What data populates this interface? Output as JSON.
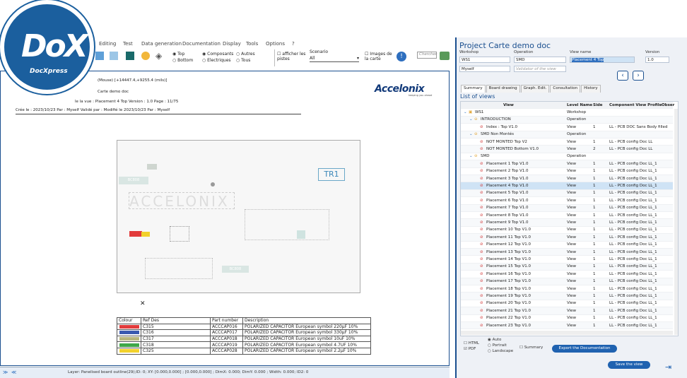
{
  "logo": {
    "brand": "DoX",
    "sub": "DocXpress"
  },
  "menu": [
    "Editing",
    "Test",
    "Data generation",
    "Documentation",
    "Display",
    "Tools",
    "Options",
    "?"
  ],
  "toolbar": {
    "top_label": "Top",
    "bottom_label": "Bottom",
    "composants": "Composants",
    "electriques": "Electriques",
    "autres": "Autres",
    "tous": "Tous",
    "afficher_pistes": "afficher les pistes",
    "scenario_label": "Scenario",
    "scenario_value": "All",
    "images_carte": "Images de la carte",
    "search_placeholder": "Chercher"
  },
  "doc": {
    "mouse": "(Mouse) [+14447.4,+9255.4 (mils)]",
    "project": "Carte demo doc",
    "view_line": "le la vue : Placement 4 Top   Version : 1.0   Page : 11/75",
    "created_line": "Crée le :  2023/10/23    Par : Myself   Validé par :     Modifié le 2023/10/23    Par : Myself",
    "brand": "Accelonix",
    "brand_tag": "keeping you ahead",
    "board_text1": "TR1",
    "board_text2": "ACCELONIX",
    "board_text3": "BC808",
    "board_text4": "BC808",
    "legend_headers": [
      "Colour",
      "Ref Des",
      "Part number",
      "Description"
    ],
    "legend_rows": [
      {
        "color": "#e23b3b",
        "ref": "C315",
        "part": "ACCCAP016",
        "desc": "POLARIZED CAPACITOR European symbol 220µF 10%"
      },
      {
        "color": "#3b5ab0",
        "ref": "C316",
        "part": "ACCCAP017",
        "desc": "POLARIZED CAPACITOR European symbol 330µF 10%"
      },
      {
        "color": "#b9b77e",
        "ref": "C317",
        "part": "ACCCAP018",
        "desc": "POLARIZED CAPACITOR European symbol 10uF 10%"
      },
      {
        "color": "#3fa748",
        "ref": "C318",
        "part": "ACCCAP019",
        "desc": "POLARIZED CAPACITOR European symbol 4.7UF 10%"
      },
      {
        "color": "#f2d12c",
        "ref": "C325",
        "part": "ACCCAP028",
        "desc": "POLARIZED CAPACITOR European symbol 2.2µF 10%"
      }
    ]
  },
  "status": "Layer: Panelised board outline(29);ID: 0; XY: [0.000,0.000] ; [0.000,0.000] ; DimX: 0.000; DimY: 0.000 ; Width: 0.000; ID2: 0",
  "panel": {
    "title": "Project  Carte demo doc",
    "workshop_label": "Workshop",
    "operation_label": "Operation",
    "viewname_label": "View name",
    "version_label": "Version",
    "workshop": "WS1",
    "operation": "SMD",
    "viewname": "Placement 4 Top",
    "version": "1.0",
    "user": "Myself",
    "validator_placeholder": "Validator of the view",
    "prev": "‹",
    "next": "›",
    "tabs": [
      "Summary",
      "Board drawing",
      "Graph. Edit.",
      "Consultation",
      "History"
    ],
    "list_title": "List of views",
    "columns": [
      "View",
      "Level Name",
      "Side",
      "Component View Profile",
      "Obser"
    ],
    "rows": [
      {
        "name": "WS1",
        "level": "Workshop",
        "side": "",
        "profile": "",
        "indent": 0,
        "kind": "ws"
      },
      {
        "name": "INTRODUCTION",
        "level": "Operation",
        "side": "",
        "profile": "",
        "indent": 1,
        "kind": "op"
      },
      {
        "name": "Index : Top V1.0",
        "level": "View",
        "side": "1",
        "profile": "LL - PCB DOC Sans Body filled",
        "indent": 2,
        "kind": "v"
      },
      {
        "name": "SMD Non Montés",
        "level": "Operation",
        "side": "",
        "profile": "",
        "indent": 1,
        "kind": "op"
      },
      {
        "name": "NOT MONTED Top V2",
        "level": "View",
        "side": "1",
        "profile": "LL - PCB config Doc LL",
        "indent": 2,
        "kind": "v"
      },
      {
        "name": "NOT MONTED Bottom V1.0",
        "level": "View",
        "side": "2",
        "profile": "LL - PCB config Doc LL",
        "indent": 2,
        "kind": "v"
      },
      {
        "name": "SMD",
        "level": "Operation",
        "side": "",
        "profile": "",
        "indent": 1,
        "kind": "op"
      },
      {
        "name": "Placement 1 Top V1.0",
        "level": "View",
        "side": "1",
        "profile": "LL - PCB config Doc LL_1",
        "indent": 2,
        "kind": "v"
      },
      {
        "name": "Placement 2 Top V1.0",
        "level": "View",
        "side": "1",
        "profile": "LL - PCB config Doc LL_1",
        "indent": 2,
        "kind": "v"
      },
      {
        "name": "Placement 3 Top V1.0",
        "level": "View",
        "side": "1",
        "profile": "LL - PCB config Doc LL_1",
        "indent": 2,
        "kind": "v"
      },
      {
        "name": "Placement 4 Top V1.0",
        "level": "View",
        "side": "1",
        "profile": "LL - PCB config Doc LL_1",
        "indent": 2,
        "kind": "v",
        "selected": true
      },
      {
        "name": "Placement 5 Top V1.0",
        "level": "View",
        "side": "1",
        "profile": "LL - PCB config Doc LL_1",
        "indent": 2,
        "kind": "v"
      },
      {
        "name": "Placement 6 Top V1.0",
        "level": "View",
        "side": "1",
        "profile": "LL - PCB config Doc LL_1",
        "indent": 2,
        "kind": "v"
      },
      {
        "name": "Placement 7 Top V1.0",
        "level": "View",
        "side": "1",
        "profile": "LL - PCB config Doc LL_1",
        "indent": 2,
        "kind": "v"
      },
      {
        "name": "Placement 8 Top V1.0",
        "level": "View",
        "side": "1",
        "profile": "LL - PCB config Doc LL_1",
        "indent": 2,
        "kind": "v"
      },
      {
        "name": "Placement 9 Top V1.0",
        "level": "View",
        "side": "1",
        "profile": "LL - PCB config Doc LL_1",
        "indent": 2,
        "kind": "v"
      },
      {
        "name": "Placement 10 Top V1.0",
        "level": "View",
        "side": "1",
        "profile": "LL - PCB config Doc LL_1",
        "indent": 2,
        "kind": "v"
      },
      {
        "name": "Placement 11 Top V1.0",
        "level": "View",
        "side": "1",
        "profile": "LL - PCB config Doc LL_1",
        "indent": 2,
        "kind": "v"
      },
      {
        "name": "Placement 12 Top V1.0",
        "level": "View",
        "side": "1",
        "profile": "LL - PCB config Doc LL_1",
        "indent": 2,
        "kind": "v"
      },
      {
        "name": "Placement 13 Top V1.0",
        "level": "View",
        "side": "1",
        "profile": "LL - PCB config Doc LL_1",
        "indent": 2,
        "kind": "v"
      },
      {
        "name": "Placement 14 Top V1.0",
        "level": "View",
        "side": "1",
        "profile": "LL - PCB config Doc LL_1",
        "indent": 2,
        "kind": "v"
      },
      {
        "name": "Placement 15 Top V1.0",
        "level": "View",
        "side": "1",
        "profile": "LL - PCB config Doc LL_1",
        "indent": 2,
        "kind": "v"
      },
      {
        "name": "Placement 16 Top V1.0",
        "level": "View",
        "side": "1",
        "profile": "LL - PCB config Doc LL_1",
        "indent": 2,
        "kind": "v"
      },
      {
        "name": "Placement 17 Top V1.0",
        "level": "View",
        "side": "1",
        "profile": "LL - PCB config Doc LL_1",
        "indent": 2,
        "kind": "v"
      },
      {
        "name": "Placement 18 Top V1.0",
        "level": "View",
        "side": "1",
        "profile": "LL - PCB config Doc LL_1",
        "indent": 2,
        "kind": "v"
      },
      {
        "name": "Placement 19 Top V1.0",
        "level": "View",
        "side": "1",
        "profile": "LL - PCB config Doc LL_1",
        "indent": 2,
        "kind": "v"
      },
      {
        "name": "Placement 20 Top V1.0",
        "level": "View",
        "side": "1",
        "profile": "LL - PCB config Doc LL_1",
        "indent": 2,
        "kind": "v"
      },
      {
        "name": "Placement 21 Top V1.0",
        "level": "View",
        "side": "1",
        "profile": "LL - PCB config Doc LL_1",
        "indent": 2,
        "kind": "v"
      },
      {
        "name": "Placement 22 Top V1.0",
        "level": "View",
        "side": "1",
        "profile": "LL - PCB config Doc LL_1",
        "indent": 2,
        "kind": "v"
      },
      {
        "name": "Placement 23 Top V1.0",
        "level": "View",
        "side": "1",
        "profile": "LL - PCB config Doc LL_1",
        "indent": 2,
        "kind": "v"
      }
    ],
    "html_label": "HTML",
    "pdf_label": "PDF",
    "auto_label": "Auto",
    "portrait_label": "Portrait",
    "landscape_label": "Landscape",
    "summary_label": "Summary",
    "export_button": "Export the Documentation",
    "save_button": "Save the view"
  }
}
